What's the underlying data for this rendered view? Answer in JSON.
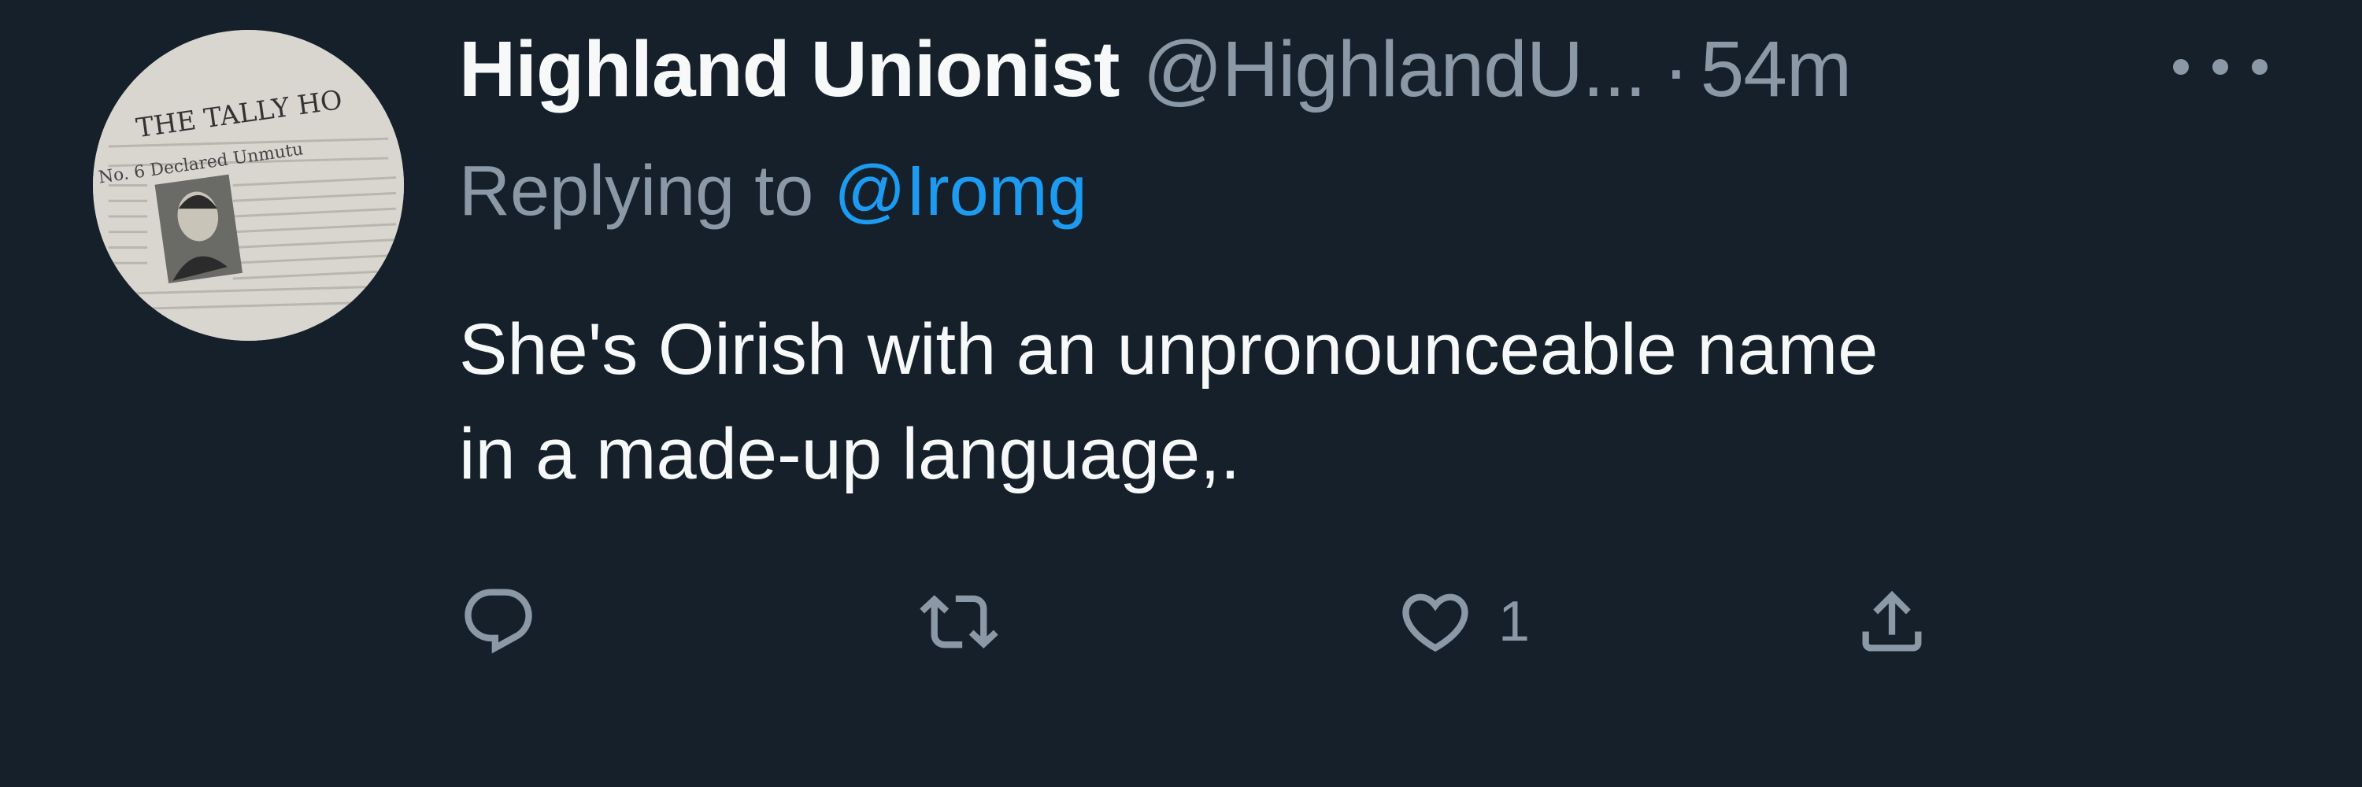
{
  "tweet": {
    "author": {
      "display_name": "Highland Unionist",
      "handle": "@HighlandU...",
      "avatar": {
        "icon": "newspaper-avatar",
        "headline": "THE TALLY HO",
        "subline": "No. 6 Declared Unmutu"
      }
    },
    "separator": "·",
    "timestamp": "54m",
    "more_icon": "more-dots-icon",
    "replying": {
      "prefix": "Replying to",
      "target": "@Iromg"
    },
    "text_lines": [
      "She's Oirish with an unpronounceable name",
      "in a made-up language,."
    ],
    "actions": {
      "reply": {
        "icon": "reply-icon",
        "count": ""
      },
      "retweet": {
        "icon": "retweet-icon",
        "count": ""
      },
      "like": {
        "icon": "heart-icon",
        "count": "1"
      },
      "share": {
        "icon": "share-icon",
        "count": ""
      }
    }
  },
  "colors": {
    "background": "#15202b",
    "primary_text": "#f7f9f9",
    "secondary_text": "#8b98a5",
    "link": "#1d9bf0"
  }
}
